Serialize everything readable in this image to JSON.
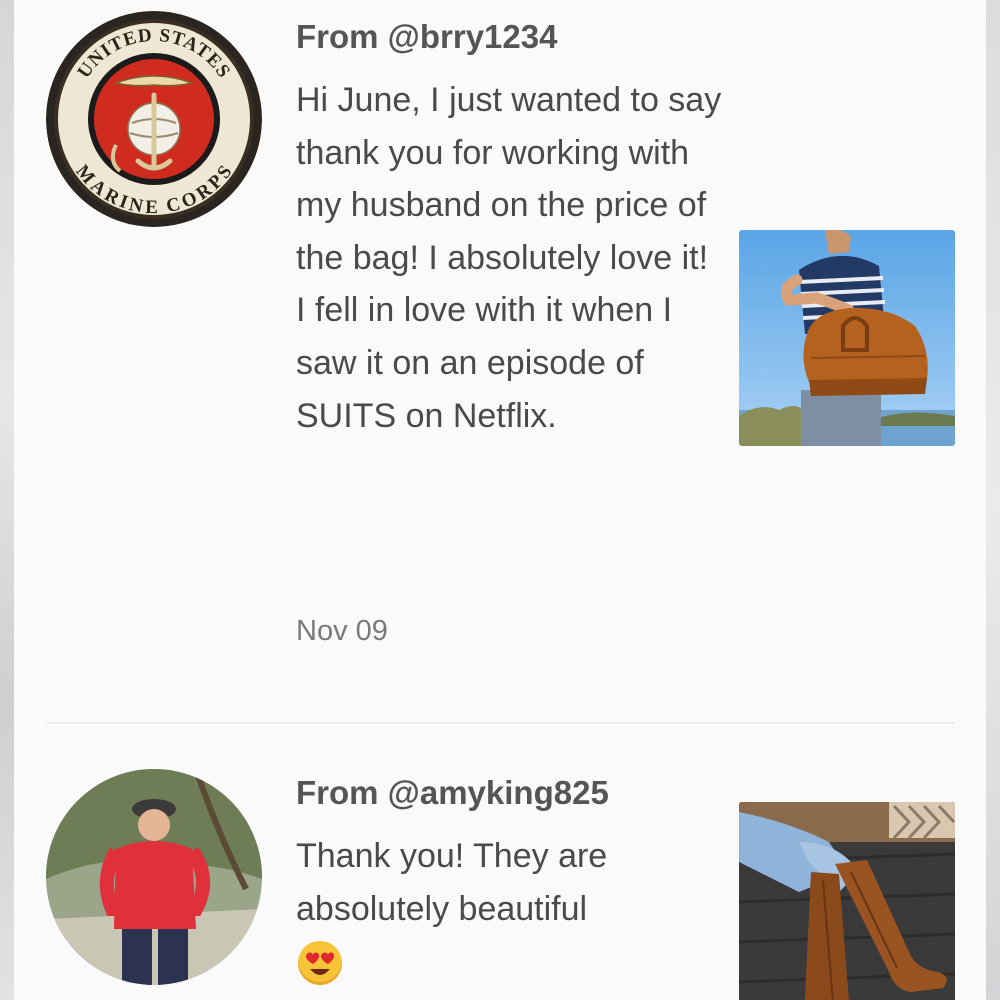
{
  "reviews": [
    {
      "from": "From @brry1234",
      "message": "Hi June, I just wanted to say thank you for working with my husband on the price of the bag! I absolutely love it! I fell in love with it when I saw it on an episode of SUITS on Netflix.",
      "date": "Nov 09",
      "avatar_label_top": "UNITED STATES",
      "avatar_label_bottom": "MARINE CORPS"
    },
    {
      "from": "From @amyking825",
      "message": "Thank you! They are absolutely beautiful",
      "emoji": "heart-eyes-emoji"
    }
  ],
  "colors": {
    "background": "#fafafa",
    "text": "#4a4a4a",
    "date": "#7a7a7a",
    "divider": "#ececea"
  }
}
